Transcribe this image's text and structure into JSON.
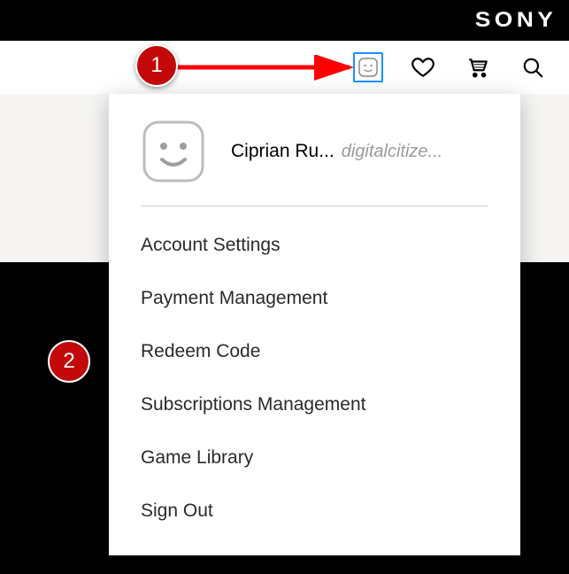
{
  "brand": {
    "logo": "SONY"
  },
  "profile": {
    "display_name": "Ciprian Ru...",
    "handle": "digitalcitize..."
  },
  "menu": {
    "items": [
      {
        "label": "Account Settings"
      },
      {
        "label": "Payment Management"
      },
      {
        "label": "Redeem Code"
      },
      {
        "label": "Subscriptions Management"
      },
      {
        "label": "Game Library"
      },
      {
        "label": "Sign Out"
      }
    ]
  },
  "annotations": {
    "badge1": "1",
    "badge2": "2"
  }
}
